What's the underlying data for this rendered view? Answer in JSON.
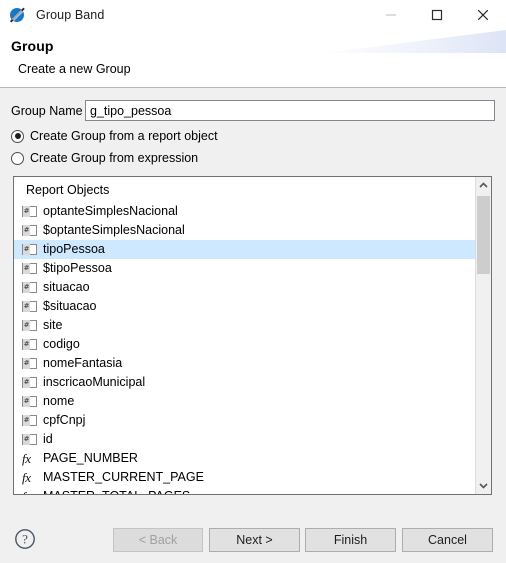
{
  "window": {
    "title": "Group Band",
    "icon": "group-band-icon",
    "controls": {
      "minimize": "minimize-icon",
      "maximize": "maximize-icon",
      "close": "close-icon"
    }
  },
  "header": {
    "title": "Group",
    "subtitle": "Create a new Group"
  },
  "form": {
    "group_name_label": "Group Name",
    "group_name_value": "g_tipo_pessoa",
    "group_name_placeholder": "",
    "radios": [
      {
        "label": "Create Group from a report object",
        "checked": true
      },
      {
        "label": "Create Group from expression",
        "checked": false
      }
    ]
  },
  "list": {
    "header": "Report Objects",
    "items": [
      {
        "label": "optanteSimplesNacional",
        "icon": "data-field-icon",
        "selected": false
      },
      {
        "label": "$optanteSimplesNacional",
        "icon": "data-field-icon",
        "selected": false
      },
      {
        "label": "tipoPessoa",
        "icon": "data-field-icon",
        "selected": true
      },
      {
        "label": "$tipoPessoa",
        "icon": "data-field-icon",
        "selected": false
      },
      {
        "label": "situacao",
        "icon": "data-field-icon",
        "selected": false
      },
      {
        "label": "$situacao",
        "icon": "data-field-icon",
        "selected": false
      },
      {
        "label": "site",
        "icon": "data-field-icon",
        "selected": false
      },
      {
        "label": "codigo",
        "icon": "data-field-icon",
        "selected": false
      },
      {
        "label": "nomeFantasia",
        "icon": "data-field-icon",
        "selected": false
      },
      {
        "label": "inscricaoMunicipal",
        "icon": "data-field-icon",
        "selected": false
      },
      {
        "label": "nome",
        "icon": "data-field-icon",
        "selected": false
      },
      {
        "label": "cpfCnpj",
        "icon": "data-field-icon",
        "selected": false
      },
      {
        "label": "id",
        "icon": "data-field-icon",
        "selected": false
      },
      {
        "label": "PAGE_NUMBER",
        "icon": "function-icon",
        "selected": false
      },
      {
        "label": "MASTER_CURRENT_PAGE",
        "icon": "function-icon",
        "selected": false
      },
      {
        "label": "MASTER_TOTAL_PAGES",
        "icon": "function-icon",
        "selected": false
      }
    ],
    "scrollbar": {
      "up_arrow": "chevron-up-icon",
      "down_arrow": "chevron-down-icon"
    }
  },
  "footer": {
    "help": "help-icon",
    "buttons": [
      {
        "label": "< Back",
        "disabled": true
      },
      {
        "label": "Next >",
        "disabled": false
      },
      {
        "label": "Finish",
        "disabled": false
      },
      {
        "label": "Cancel",
        "disabled": false
      }
    ]
  },
  "colors": {
    "selection": "#cde8ff",
    "accent": "#1878c8",
    "window_bg": "#f0f0f0",
    "field_bg": "#ffffff"
  }
}
